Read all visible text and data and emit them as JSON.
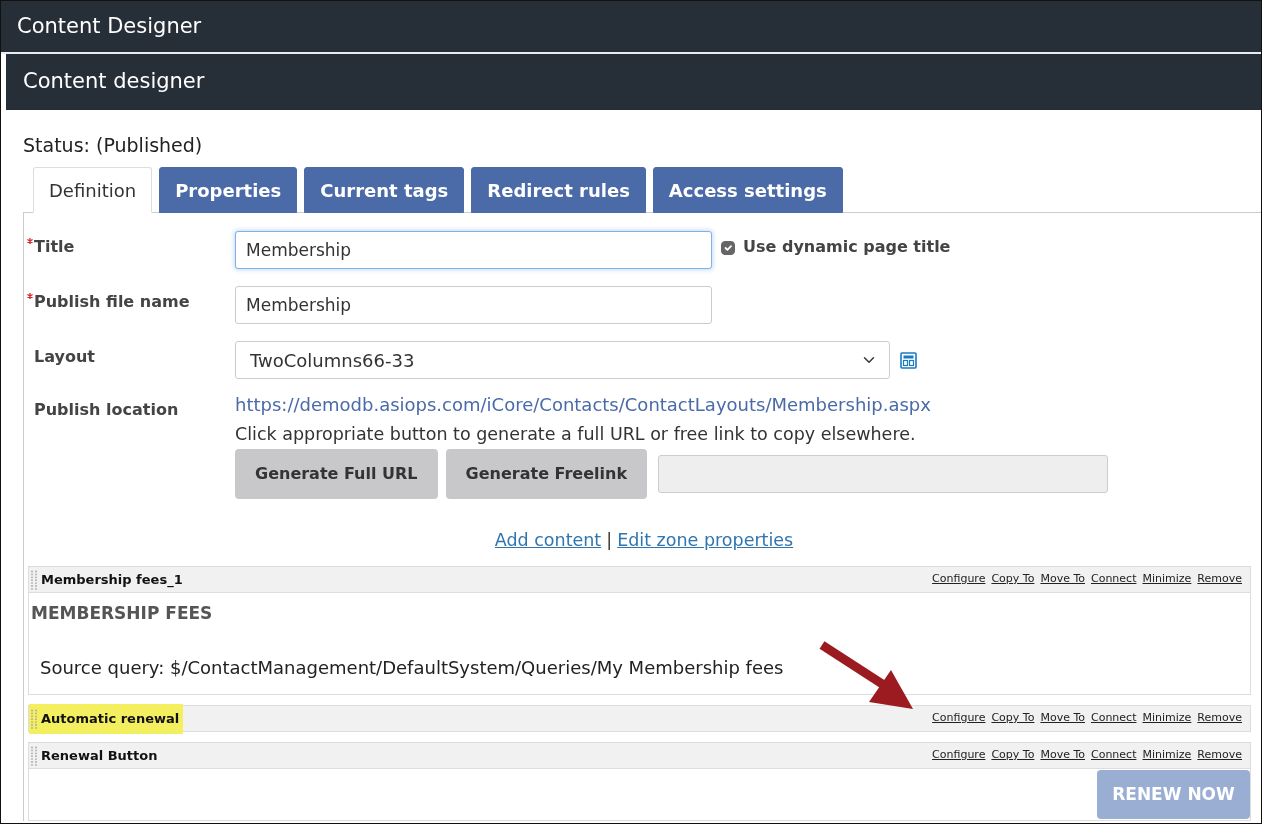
{
  "app": {
    "title": "Content Designer"
  },
  "panel": {
    "title": "Content designer",
    "status": "Status: (Published)"
  },
  "tabs": [
    {
      "label": "Definition",
      "selected": true
    },
    {
      "label": "Properties",
      "selected": false
    },
    {
      "label": "Current tags",
      "selected": false
    },
    {
      "label": "Redirect rules",
      "selected": false
    },
    {
      "label": "Access settings",
      "selected": false
    }
  ],
  "fields": [
    {
      "kind": "text",
      "label": "Title",
      "required": true,
      "value": "Membership",
      "focused": true,
      "option": {
        "label": "Use dynamic page title",
        "checked": true
      }
    },
    {
      "kind": "text",
      "label": "Publish file name",
      "required": true,
      "value": "Membership",
      "focused": false
    },
    {
      "kind": "select",
      "label": "Layout",
      "required": false,
      "value": "TwoColumns66-33"
    },
    {
      "kind": "location",
      "label": "Publish location",
      "required": false,
      "link": "https://demodb.asiops.com/iCore/Contacts/ContactLayouts/Membership.aspx",
      "hint": "Click appropriate button to generate a full URL or free link to copy elsewhere.",
      "buttons": [
        "Generate Full URL",
        "Generate Freelink"
      ],
      "output": {
        "readonly": true
      }
    }
  ],
  "zone_links": {
    "items": [
      "Add content",
      "Edit zone properties"
    ],
    "separator": "|"
  },
  "web_parts": [
    {
      "title": "Membership fees_1",
      "highlighted": false,
      "actions": [
        "Configure",
        "Copy To",
        "Move To",
        "Connect",
        "Minimize",
        "Remove"
      ],
      "content": {
        "kind": "query",
        "heading": "MEMBERSHIP FEES",
        "text": "Source query: $/ContactManagement/DefaultSystem/Queries/My Membership fees"
      }
    },
    {
      "title": "Automatic renewal",
      "highlighted": true,
      "actions": [
        "Configure",
        "Copy To",
        "Move To",
        "Connect",
        "Minimize",
        "Remove"
      ]
    },
    {
      "title": "Renewal Button",
      "highlighted": false,
      "actions": [
        "Configure",
        "Copy To",
        "Move To",
        "Connect",
        "Minimize",
        "Remove"
      ],
      "content": {
        "kind": "button",
        "label": "RENEW NOW",
        "disabled": true
      }
    }
  ]
}
